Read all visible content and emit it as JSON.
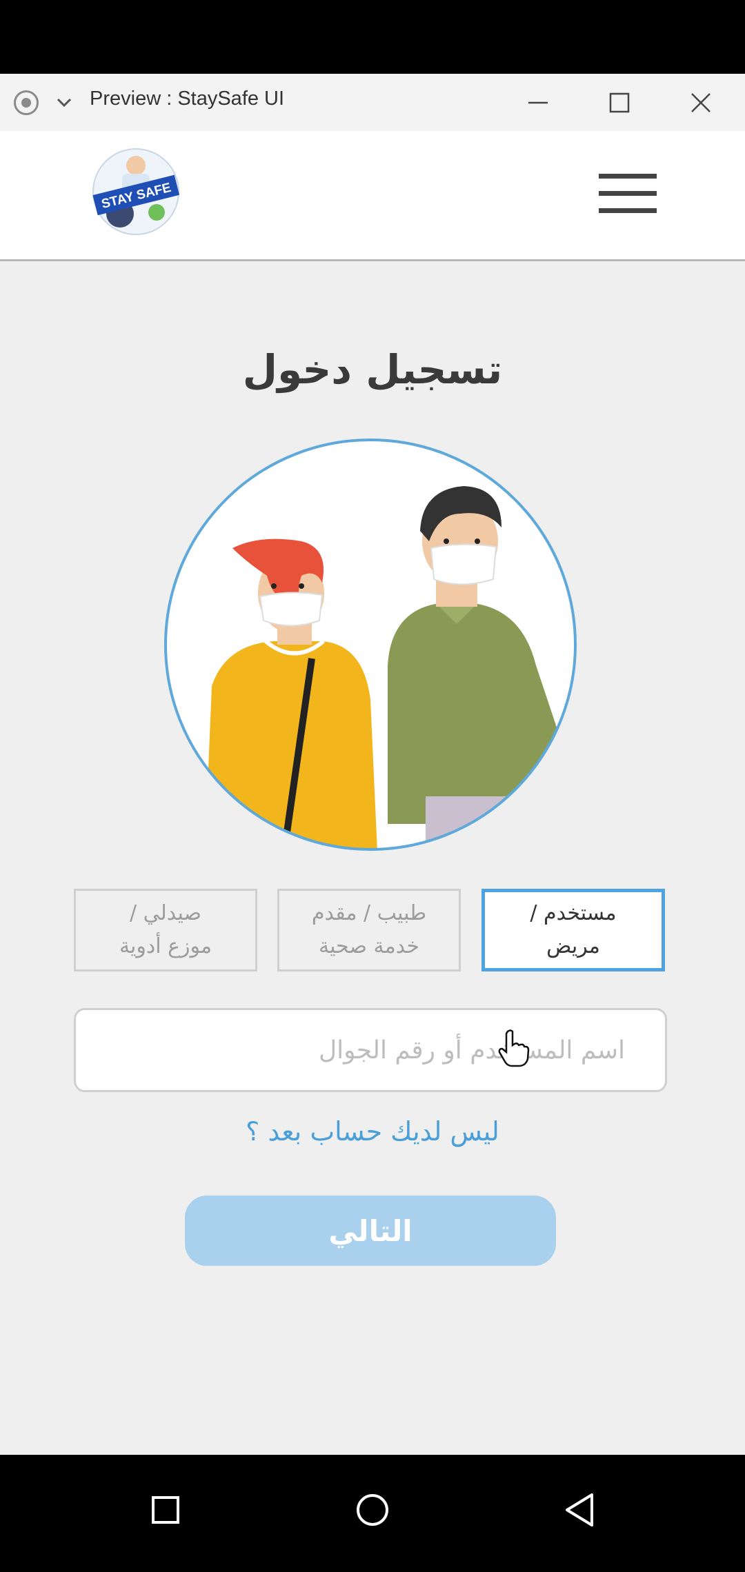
{
  "window": {
    "title": "Preview : StaySafe UI"
  },
  "header": {
    "logo_text": "STAY SAFE"
  },
  "login": {
    "heading": "تسجيل دخول",
    "roles": [
      {
        "line1": "مستخدم /",
        "line2": "مريض",
        "active": true
      },
      {
        "line1": "طبيب / مقدم",
        "line2": "خدمة صحية",
        "active": false
      },
      {
        "line1": "صيدلي /",
        "line2": "موزع أدوية",
        "active": false
      }
    ],
    "input_placeholder": "اسم المستخدم أو رقم الجوال",
    "signup_link": "ليس لديك حساب بعد ؟",
    "next_button": "التالي"
  },
  "colors": {
    "accent": "#4ea3e0",
    "button": "#a9d0ed",
    "link": "#4a9fd8"
  }
}
